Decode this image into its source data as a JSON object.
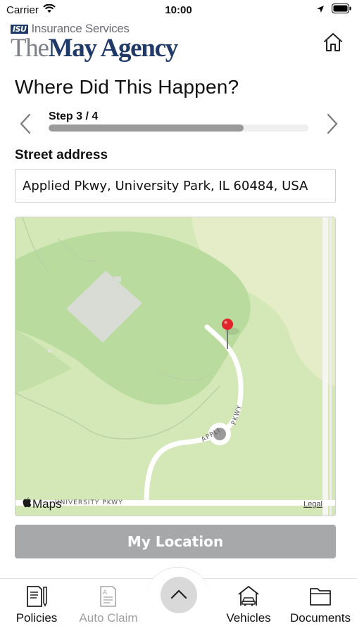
{
  "status_bar": {
    "carrier": "Carrier",
    "time": "10:00",
    "icons": [
      "wifi-icon",
      "location-arrow-icon",
      "battery-icon"
    ]
  },
  "header": {
    "logo_badge": "ISU",
    "logo_sub": "Insurance Services",
    "logo_the": "The",
    "logo_name": "May Agency",
    "home_icon": "home-icon"
  },
  "page": {
    "title": "Where Did This Happen?"
  },
  "stepper": {
    "label": "Step 3 / 4",
    "progress": 0.75,
    "prev_icon": "chevron-left-icon",
    "next_icon": "chevron-right-icon"
  },
  "address": {
    "label": "Street address",
    "value": "Applied Pkwy, University Park, IL 60484, USA"
  },
  "map": {
    "attribution": "Maps",
    "legal": "Legal",
    "street_pkwy": "PKWY",
    "street_applied": "APPLIED",
    "street_university": "UNIVERSITY PKWY",
    "pin_icon": "map-pin-icon",
    "user_location_icon": "user-location-dot-icon"
  },
  "actions": {
    "my_location": "My Location"
  },
  "tab_bar": {
    "items": [
      {
        "label": "Policies",
        "icon": "policy-document-icon",
        "enabled": true
      },
      {
        "label": "Auto Claim",
        "icon": "claim-form-icon",
        "enabled": false
      },
      {
        "label": "Vehicles",
        "icon": "car-garage-icon",
        "enabled": true
      },
      {
        "label": "Documents",
        "icon": "folder-icon",
        "enabled": true
      }
    ],
    "center_icon": "chevron-up-icon"
  },
  "colors": {
    "brand_navy": "#1f3a68",
    "map_green": "#cfe6b3",
    "map_park": "#b9dc9c",
    "pin_red": "#e0242a",
    "button_gray": "#a7a8aa"
  }
}
